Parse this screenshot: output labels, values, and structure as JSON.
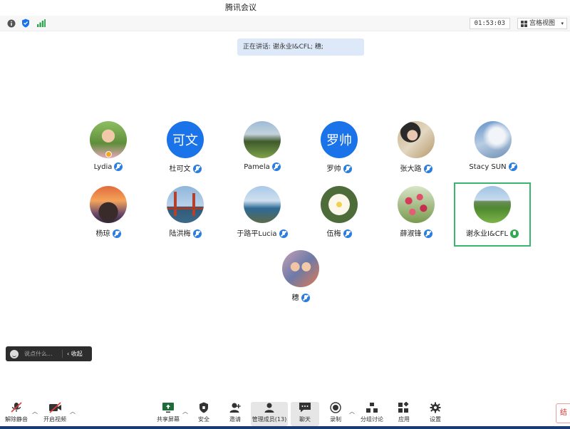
{
  "window": {
    "title": "腾讯会议"
  },
  "topbar": {
    "timer": "01:53:03",
    "view_label": "宫格视图"
  },
  "speaking": {
    "text": "正在讲话: 谢永业I&CFL; 穗;"
  },
  "participants": [
    {
      "name": "Lydia",
      "mic": "muted"
    },
    {
      "name": "杜可文",
      "mic": "muted",
      "avatar_text": "可文"
    },
    {
      "name": "Pamela",
      "mic": "muted"
    },
    {
      "name": "罗帅",
      "mic": "muted",
      "avatar_text": "罗帅"
    },
    {
      "name": "张大路",
      "mic": "muted"
    },
    {
      "name": "Stacy SUN",
      "mic": "muted"
    },
    {
      "name": "杨琼",
      "mic": "muted"
    },
    {
      "name": "陆洪梅",
      "mic": "muted"
    },
    {
      "name": "于路平Lucia",
      "mic": "muted"
    },
    {
      "name": "伍梅",
      "mic": "muted"
    },
    {
      "name": "薛淑锋",
      "mic": "muted"
    },
    {
      "name": "谢永业I&CFL",
      "mic": "on"
    },
    {
      "name": "穗",
      "mic": "muted"
    }
  ],
  "chat": {
    "placeholder": "说点什么...",
    "collapse_label": "收起"
  },
  "bottombar": {
    "unmute": "解除静音",
    "video": "开启视频",
    "share": "共享屏幕",
    "security": "安全",
    "invite": "邀请",
    "members": "管理成员(13)",
    "chat": "聊天",
    "record": "录制",
    "breakout": "分组讨论",
    "apps": "应用",
    "settings": "设置"
  },
  "side_button": {
    "label": "结"
  },
  "colors": {
    "accent": "#1a73e8",
    "highlight": "#3bb66e",
    "bottom_stripe": "#1b3b73"
  }
}
